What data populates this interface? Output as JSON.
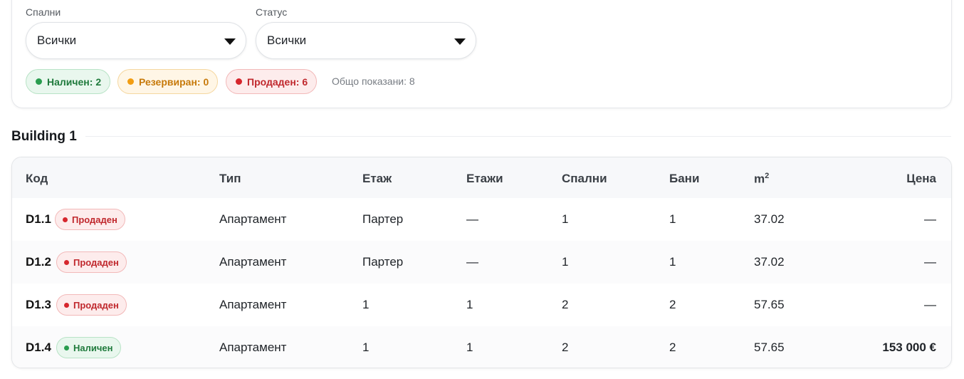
{
  "filters": {
    "bedrooms": {
      "label": "Спални",
      "value": "Всички"
    },
    "status": {
      "label": "Статус",
      "value": "Всички"
    }
  },
  "chips": {
    "available": "Наличен: 2",
    "reserved": "Резервиран: 0",
    "sold": "Продаден: 6",
    "total": "Общо показани: 8"
  },
  "colors": {
    "available": "#2a9d4f",
    "reserved": "#f29d12",
    "sold": "#d6262d"
  },
  "section": {
    "title": "Building 1"
  },
  "table": {
    "headers": {
      "code": "Код",
      "type": "Тип",
      "floor": "Етаж",
      "floors": "Етажи",
      "bedrooms": "Спални",
      "baths": "Бани",
      "area": "m",
      "area_sup": "2",
      "price": "Цена"
    },
    "rows": [
      {
        "code": "D1.1",
        "status": "Продаден",
        "type": "Апартамент",
        "floor": "Партер",
        "floors": "—",
        "bedrooms": "1",
        "baths": "1",
        "area": "37.02",
        "price": "—"
      },
      {
        "code": "D1.2",
        "status": "Продаден",
        "type": "Апартамент",
        "floor": "Партер",
        "floors": "—",
        "bedrooms": "1",
        "baths": "1",
        "area": "37.02",
        "price": "—"
      },
      {
        "code": "D1.3",
        "status": "Продаден",
        "type": "Апартамент",
        "floor": "1",
        "floors": "1",
        "bedrooms": "2",
        "baths": "2",
        "area": "57.65",
        "price": "—"
      },
      {
        "code": "D1.4",
        "status": "Наличен",
        "type": "Апартамент",
        "floor": "1",
        "floors": "1",
        "bedrooms": "2",
        "baths": "2",
        "area": "57.65",
        "price": "153 000 €"
      }
    ]
  }
}
